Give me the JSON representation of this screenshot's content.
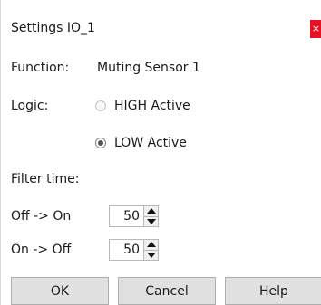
{
  "window": {
    "title": "Settings IO_1",
    "close_glyph": "×"
  },
  "function": {
    "label": "Function:",
    "value": "Muting Sensor 1"
  },
  "logic": {
    "label": "Logic:",
    "options": [
      {
        "label": "HIGH Active",
        "checked": false
      },
      {
        "label": "LOW Active",
        "checked": true
      }
    ]
  },
  "filter": {
    "label": "Filter time:",
    "off_to_on": {
      "label": "Off -> On",
      "value": "50"
    },
    "on_to_off": {
      "label": "On -> Off",
      "value": "50"
    }
  },
  "buttons": {
    "ok": "OK",
    "cancel": "Cancel",
    "help": "Help"
  },
  "colors": {
    "close_bg": "#e81123",
    "button_bg": "#e1e1e1"
  }
}
